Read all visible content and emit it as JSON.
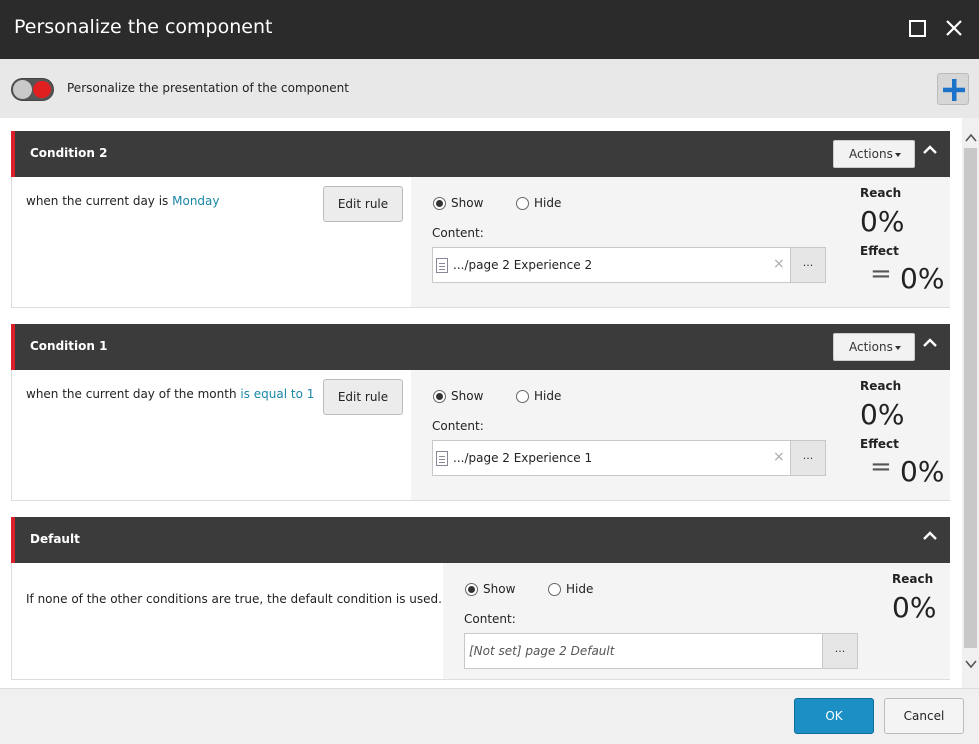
{
  "dialog": {
    "title": "Personalize the component"
  },
  "toggle": {
    "label": "Personalize the presentation of the component"
  },
  "conditions": [
    {
      "name": "Condition 2",
      "actions_label": "Actions",
      "rule_prefix": "when the current day is ",
      "rule_link": "Monday",
      "edit_label": "Edit rule",
      "show_label": "Show",
      "hide_label": "Hide",
      "selected": "Show",
      "content_label": "Content:",
      "content_value": ".../page 2 Experience 2",
      "clear": "×",
      "browse": "...",
      "reach_label": "Reach",
      "reach_value": "0%",
      "effect_label": "Effect",
      "effect_symbol": "=",
      "effect_value": "0%"
    },
    {
      "name": "Condition 1",
      "actions_label": "Actions",
      "rule_prefix": "when the current day of the month ",
      "rule_link": "is equal to 1",
      "edit_label": "Edit rule",
      "show_label": "Show",
      "hide_label": "Hide",
      "selected": "Show",
      "content_label": "Content:",
      "content_value": ".../page 2 Experience 1",
      "clear": "×",
      "browse": "...",
      "reach_label": "Reach",
      "reach_value": "0%",
      "effect_label": "Effect",
      "effect_symbol": "=",
      "effect_value": "0%"
    }
  ],
  "default": {
    "name": "Default",
    "text": "If none of the other conditions are true, the default condition is used.",
    "show_label": "Show",
    "hide_label": "Hide",
    "selected": "Show",
    "content_label": "Content:",
    "content_value": "[Not set] page 2 Default",
    "browse": "...",
    "reach_label": "Reach",
    "reach_value": "0%"
  },
  "footer": {
    "ok_label": "OK",
    "cancel_label": "Cancel"
  },
  "colors": {
    "accent_red": "#d81f2a",
    "link": "#1a86a8",
    "primary_button": "#1c8fc5",
    "header_dark": "#3b3b3b",
    "add_icon_blue": "#1a73c8"
  }
}
